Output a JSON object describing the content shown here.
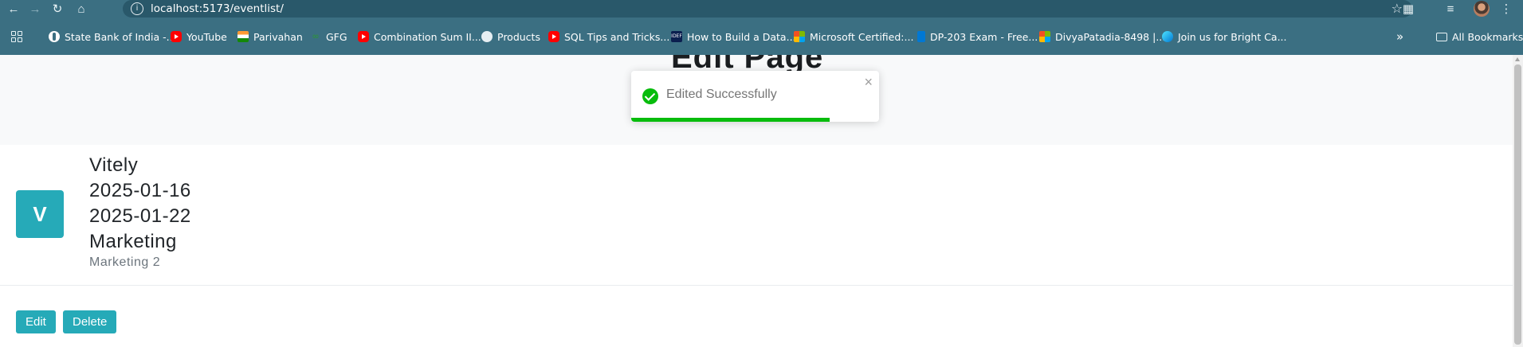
{
  "browser": {
    "url": "localhost:5173/eventlist/",
    "bookmarks": [
      {
        "label": "State Bank of India -...",
        "icon": "sbi-icon"
      },
      {
        "label": "YouTube",
        "icon": "youtube-icon"
      },
      {
        "label": "Parivahan",
        "icon": "india-flag-icon"
      },
      {
        "label": "GFG",
        "icon": "gfg-icon"
      },
      {
        "label": "Combination Sum II...",
        "icon": "youtube-icon"
      },
      {
        "label": "Products",
        "icon": "globe-icon"
      },
      {
        "label": "SQL Tips and Tricks...",
        "icon": "youtube-icon"
      },
      {
        "label": "How to Build a Data...",
        "icon": "docs-icon"
      },
      {
        "label": "Microsoft Certified:...",
        "icon": "microsoft-icon"
      },
      {
        "label": "DP-203 Exam - Free...",
        "icon": "azure-icon"
      },
      {
        "label": "DivyaPatadia-8498 |...",
        "icon": "microsoft-icon"
      },
      {
        "label": "Join us for Bright Ca...",
        "icon": "azure-icon"
      }
    ],
    "all_bookmarks": "All Bookmarks"
  },
  "page": {
    "title": "Edit Page"
  },
  "event": {
    "avatar_letter": "V",
    "name": "Vitely",
    "start_date": "2025-01-16",
    "end_date": "2025-01-22",
    "category": "Marketing",
    "sub": "Marketing 2"
  },
  "actions": {
    "edit": "Edit",
    "delete": "Delete"
  },
  "toast": {
    "message": "Edited Successfully",
    "progress": 0.8
  },
  "colors": {
    "chrome": "#3b6f82",
    "accent": "#26aab8",
    "success": "#07bc0c"
  }
}
